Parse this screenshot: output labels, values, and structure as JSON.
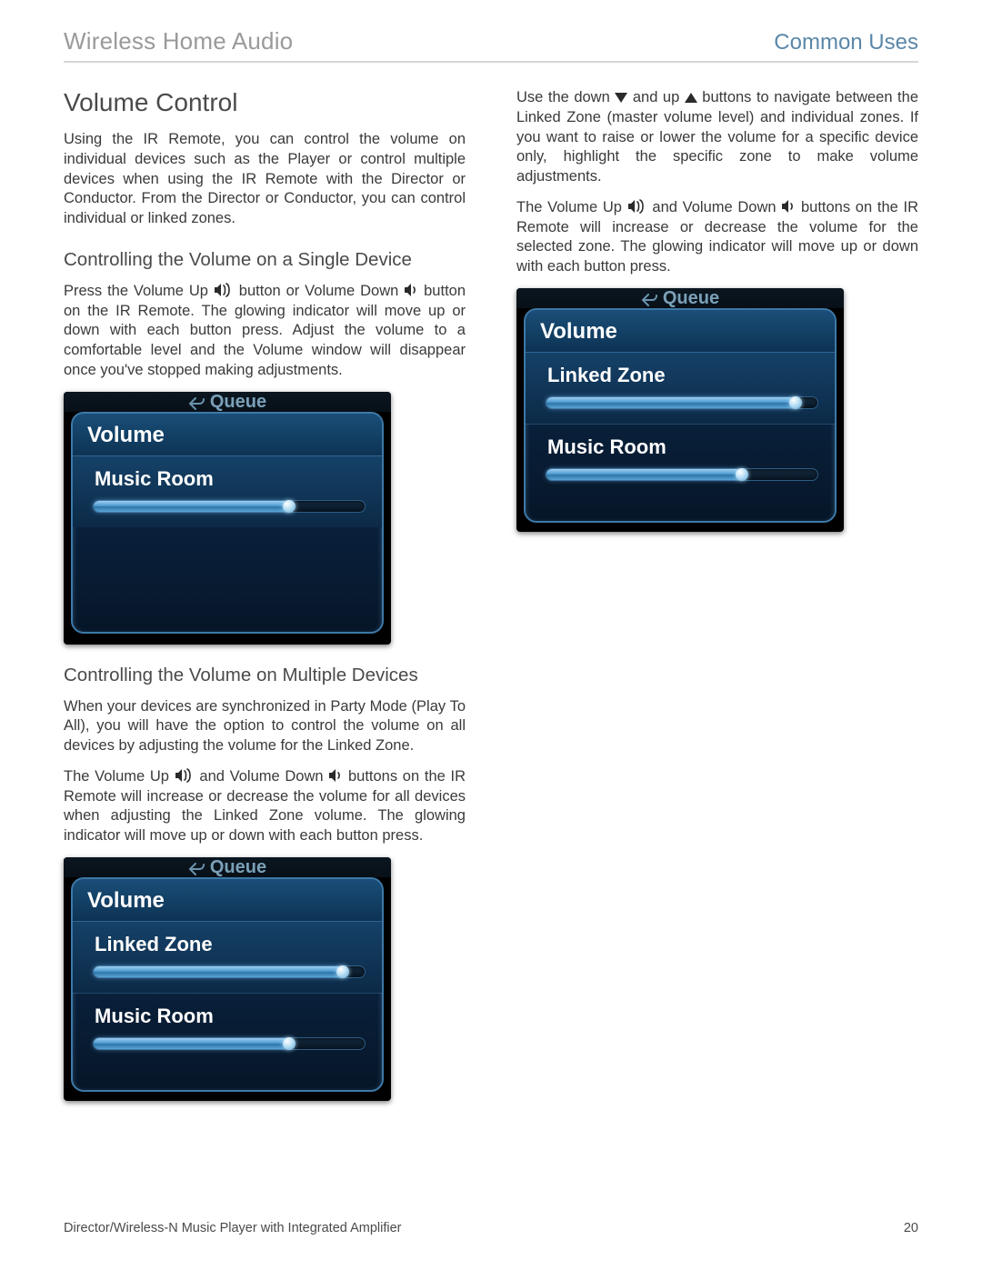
{
  "header": {
    "left": "Wireless Home Audio",
    "right": "Common Uses"
  },
  "section_title": "Volume Control",
  "left_col": {
    "intro": "Using the IR Remote, you can control the volume on individual devices such as the Player or control multiple devices when using the IR Remote with the Director or Conductor. From the Director or Conductor, you can control individual or linked zones.",
    "sub1_title": "Controlling the Volume on a Single Device",
    "sub1_p1a": "Press the Volume Up ",
    "sub1_p1b": " button or Volume Down ",
    "sub1_p1c": " button on the IR Remote. The glowing indicator will move up or down with each button press. Adjust the volume to a comfortable level and the Volume window will disappear once you've stopped making adjustments.",
    "sub2_title": "Controlling the Volume on Multiple Devices",
    "sub2_p1": "When your devices are synchronized in Party Mode (Play To All), you will have the option to control the volume on all devices by adjusting the volume for the Linked Zone.",
    "sub2_p2a": "The Volume Up ",
    "sub2_p2b": " and Volume Down ",
    "sub2_p2c": " buttons on the IR Remote will increase or decrease the volume for all devices when adjusting the Linked Zone volume. The glowing indicator will move up or down with each button press."
  },
  "right_col": {
    "p1a": "Use the down ",
    "p1b": " and up ",
    "p1c": " buttons to navigate between the Linked Zone (master volume level) and individual zones. If you want to raise or lower the volume for a specific device only, highlight the specific zone to make volume adjustments.",
    "p2a": "The Volume Up ",
    "p2b": " and Volume Down ",
    "p2c": " buttons on the IR Remote will increase or decrease the volume for the selected zone. The glowing indicator will move up or down with each button press."
  },
  "device_common": {
    "crumb": "Queue",
    "panel_title": "Volume",
    "zone_music_room": "Music Room",
    "zone_linked": "Linked Zone"
  },
  "device1": {
    "zones": [
      {
        "key": "zone_music_room",
        "fill": 72
      }
    ]
  },
  "device2": {
    "zones": [
      {
        "key": "zone_linked",
        "fill": 92
      },
      {
        "key": "zone_music_room",
        "fill": 72
      }
    ]
  },
  "device3": {
    "zones": [
      {
        "key": "zone_linked",
        "fill": 92
      },
      {
        "key": "zone_music_room",
        "fill": 72
      }
    ]
  },
  "footer": {
    "left": "Director/Wireless-N Music Player with Integrated Amplifier",
    "page": "20"
  }
}
